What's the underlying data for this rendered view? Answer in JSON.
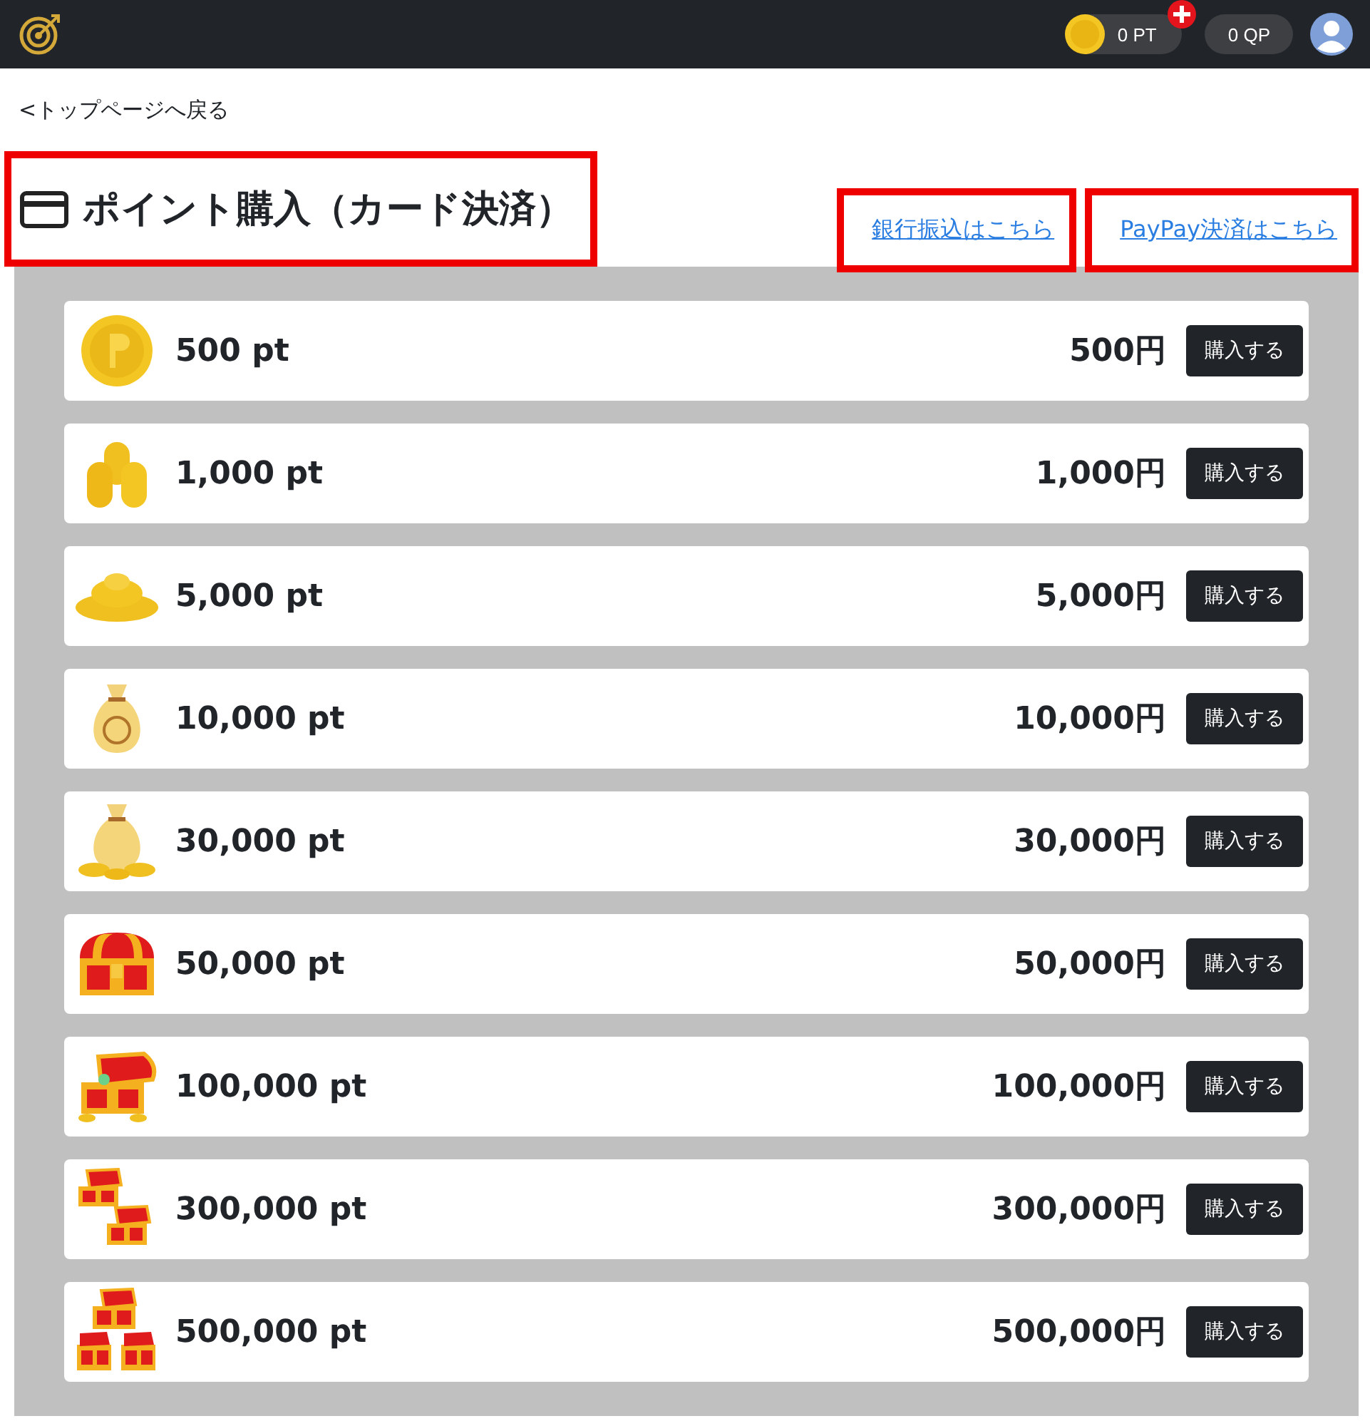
{
  "header": {
    "points": "0 PT",
    "quiz_points": "0 QP"
  },
  "back_link": "<トップページへ戻る",
  "title": "ポイント購入（カード決済）",
  "links": [
    "銀行振込はこちら",
    "PayPay決済はこちら"
  ],
  "products": [
    {
      "points": "500 pt",
      "price": "500円",
      "button": "購入する"
    },
    {
      "points": "1,000 pt",
      "price": "1,000円",
      "button": "購入する"
    },
    {
      "points": "5,000 pt",
      "price": "5,000円",
      "button": "購入する"
    },
    {
      "points": "10,000 pt",
      "price": "10,000円",
      "button": "購入する"
    },
    {
      "points": "30,000 pt",
      "price": "30,000円",
      "button": "購入する"
    },
    {
      "points": "50,000 pt",
      "price": "50,000円",
      "button": "購入する"
    },
    {
      "points": "100,000 pt",
      "price": "100,000円",
      "button": "購入する"
    },
    {
      "points": "300,000 pt",
      "price": "300,000円",
      "button": "購入する"
    },
    {
      "points": "500,000 pt",
      "price": "500,000円",
      "button": "購入する"
    }
  ]
}
